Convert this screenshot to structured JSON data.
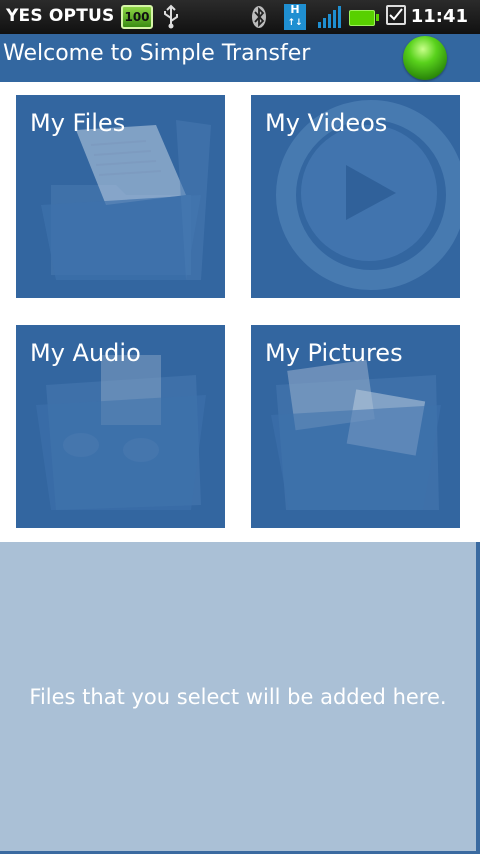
{
  "status_bar": {
    "carrier": "YES OPTUS",
    "battery_badge": "100",
    "network_type": "H",
    "time": "11:41",
    "icons": [
      "usb-icon",
      "bluetooth-icon",
      "hsdpa-icon",
      "signal-icon",
      "battery-icon",
      "checkbox-notification-icon"
    ]
  },
  "header": {
    "title": "Welcome to Simple Transfer",
    "status_indicator_color": "#3fbf14"
  },
  "tiles": [
    {
      "label": "My Files",
      "icon": "folder-documents-icon"
    },
    {
      "label": "My Videos",
      "icon": "play-video-icon"
    },
    {
      "label": "My Audio",
      "icon": "folder-music-icon"
    },
    {
      "label": "My Pictures",
      "icon": "folder-pictures-icon"
    }
  ],
  "dropzone": {
    "message": "Files that you select will be added here."
  },
  "colors": {
    "tile": "#3366a0",
    "header": "#3367a0",
    "dropzone": "#aac0d6"
  }
}
